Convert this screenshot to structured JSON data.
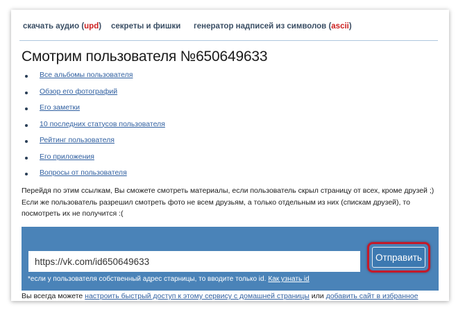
{
  "nav": {
    "audio": {
      "label": "скачать аудио (",
      "badge": "upd",
      "close": ")"
    },
    "secrets": {
      "label": "секреты и фишки"
    },
    "generator": {
      "label": "генератор надписей из символов (",
      "badge": "ascii",
      "close": ")"
    }
  },
  "page_title": "Смотрим пользователя №650649633",
  "links": [
    "Все альбомы пользователя",
    "Обзор его фотографий",
    "Его заметки",
    "10 последних статусов пользователя",
    "Рейтинг пользователя",
    "Его приложения",
    "Вопросы от пользователя"
  ],
  "info": {
    "line1": "Перейдя по этим ссылкам, Вы сможете смотреть материалы, если пользователь скрыл страницу от всех, кроме друзей ;)",
    "line2": "Если же пользователь разрешил смотреть фото не всем друзьям, а только отдельным из них (спискам друзей), то посмотреть их не получится :("
  },
  "form": {
    "url_value": "https://vk.com/id650649633",
    "submit_label": "Отправить",
    "hint_text": "*если у пользователя собственный адрес старницы, то вводите только id.",
    "hint_link": "Как узнать id"
  },
  "footer": {
    "prefix": "Вы всегда можете ",
    "link1": "настроить быстрый доступ к этому сервису с домашней страницы",
    "middle": " или ",
    "link2": "добавить сайт в избранное"
  },
  "colors": {
    "form_background": "#4a83b8",
    "highlight_ring": "#c41a2a",
    "link": "#2f5fa0",
    "badge_red": "#cc1f1f"
  }
}
